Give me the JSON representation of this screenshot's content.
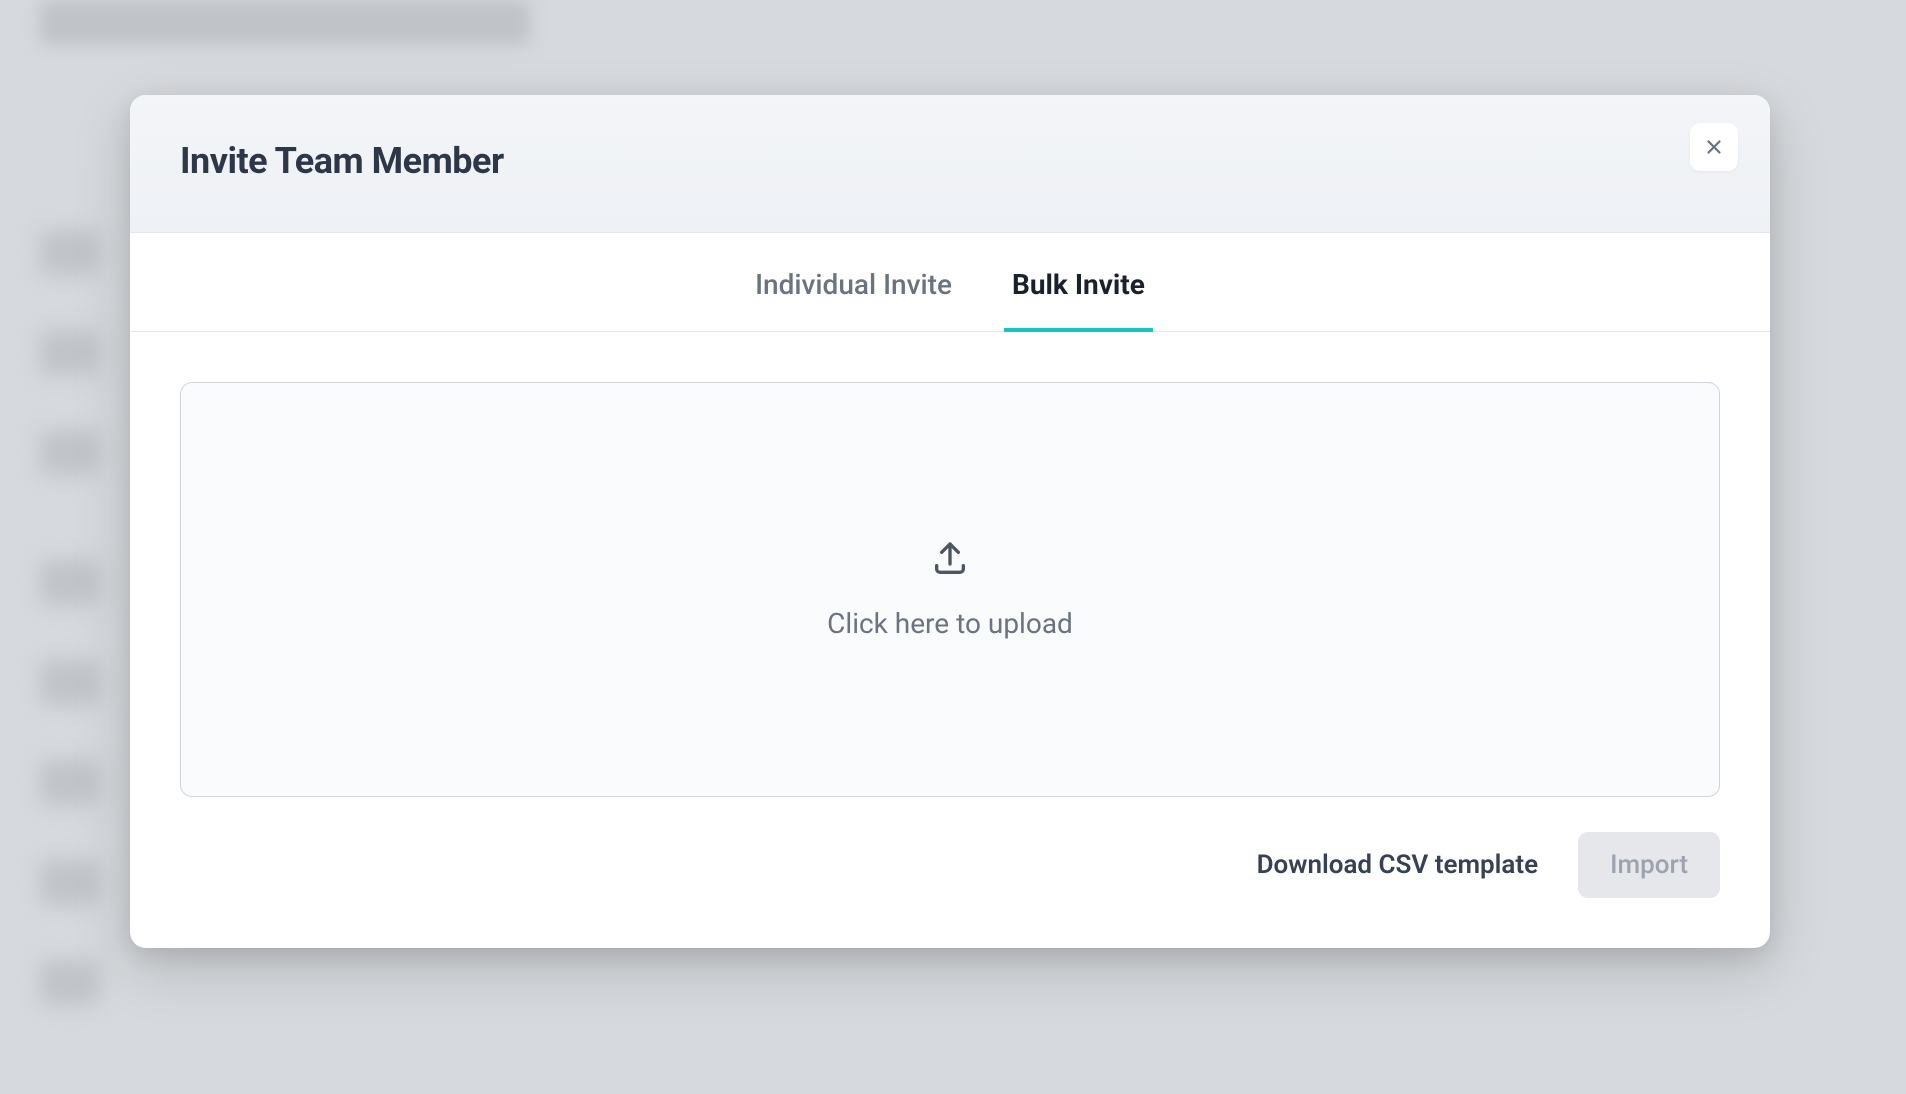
{
  "modal": {
    "title": "Invite Team Member",
    "tabs": {
      "individual": "Individual Invite",
      "bulk": "Bulk Invite",
      "active": "bulk"
    },
    "upload": {
      "text": "Click here to upload"
    },
    "footer": {
      "download_link": "Download CSV template",
      "import_button": "Import"
    }
  },
  "colors": {
    "accent": "#14c7b8",
    "text_primary": "#2d3748",
    "text_secondary": "#6b7280"
  }
}
